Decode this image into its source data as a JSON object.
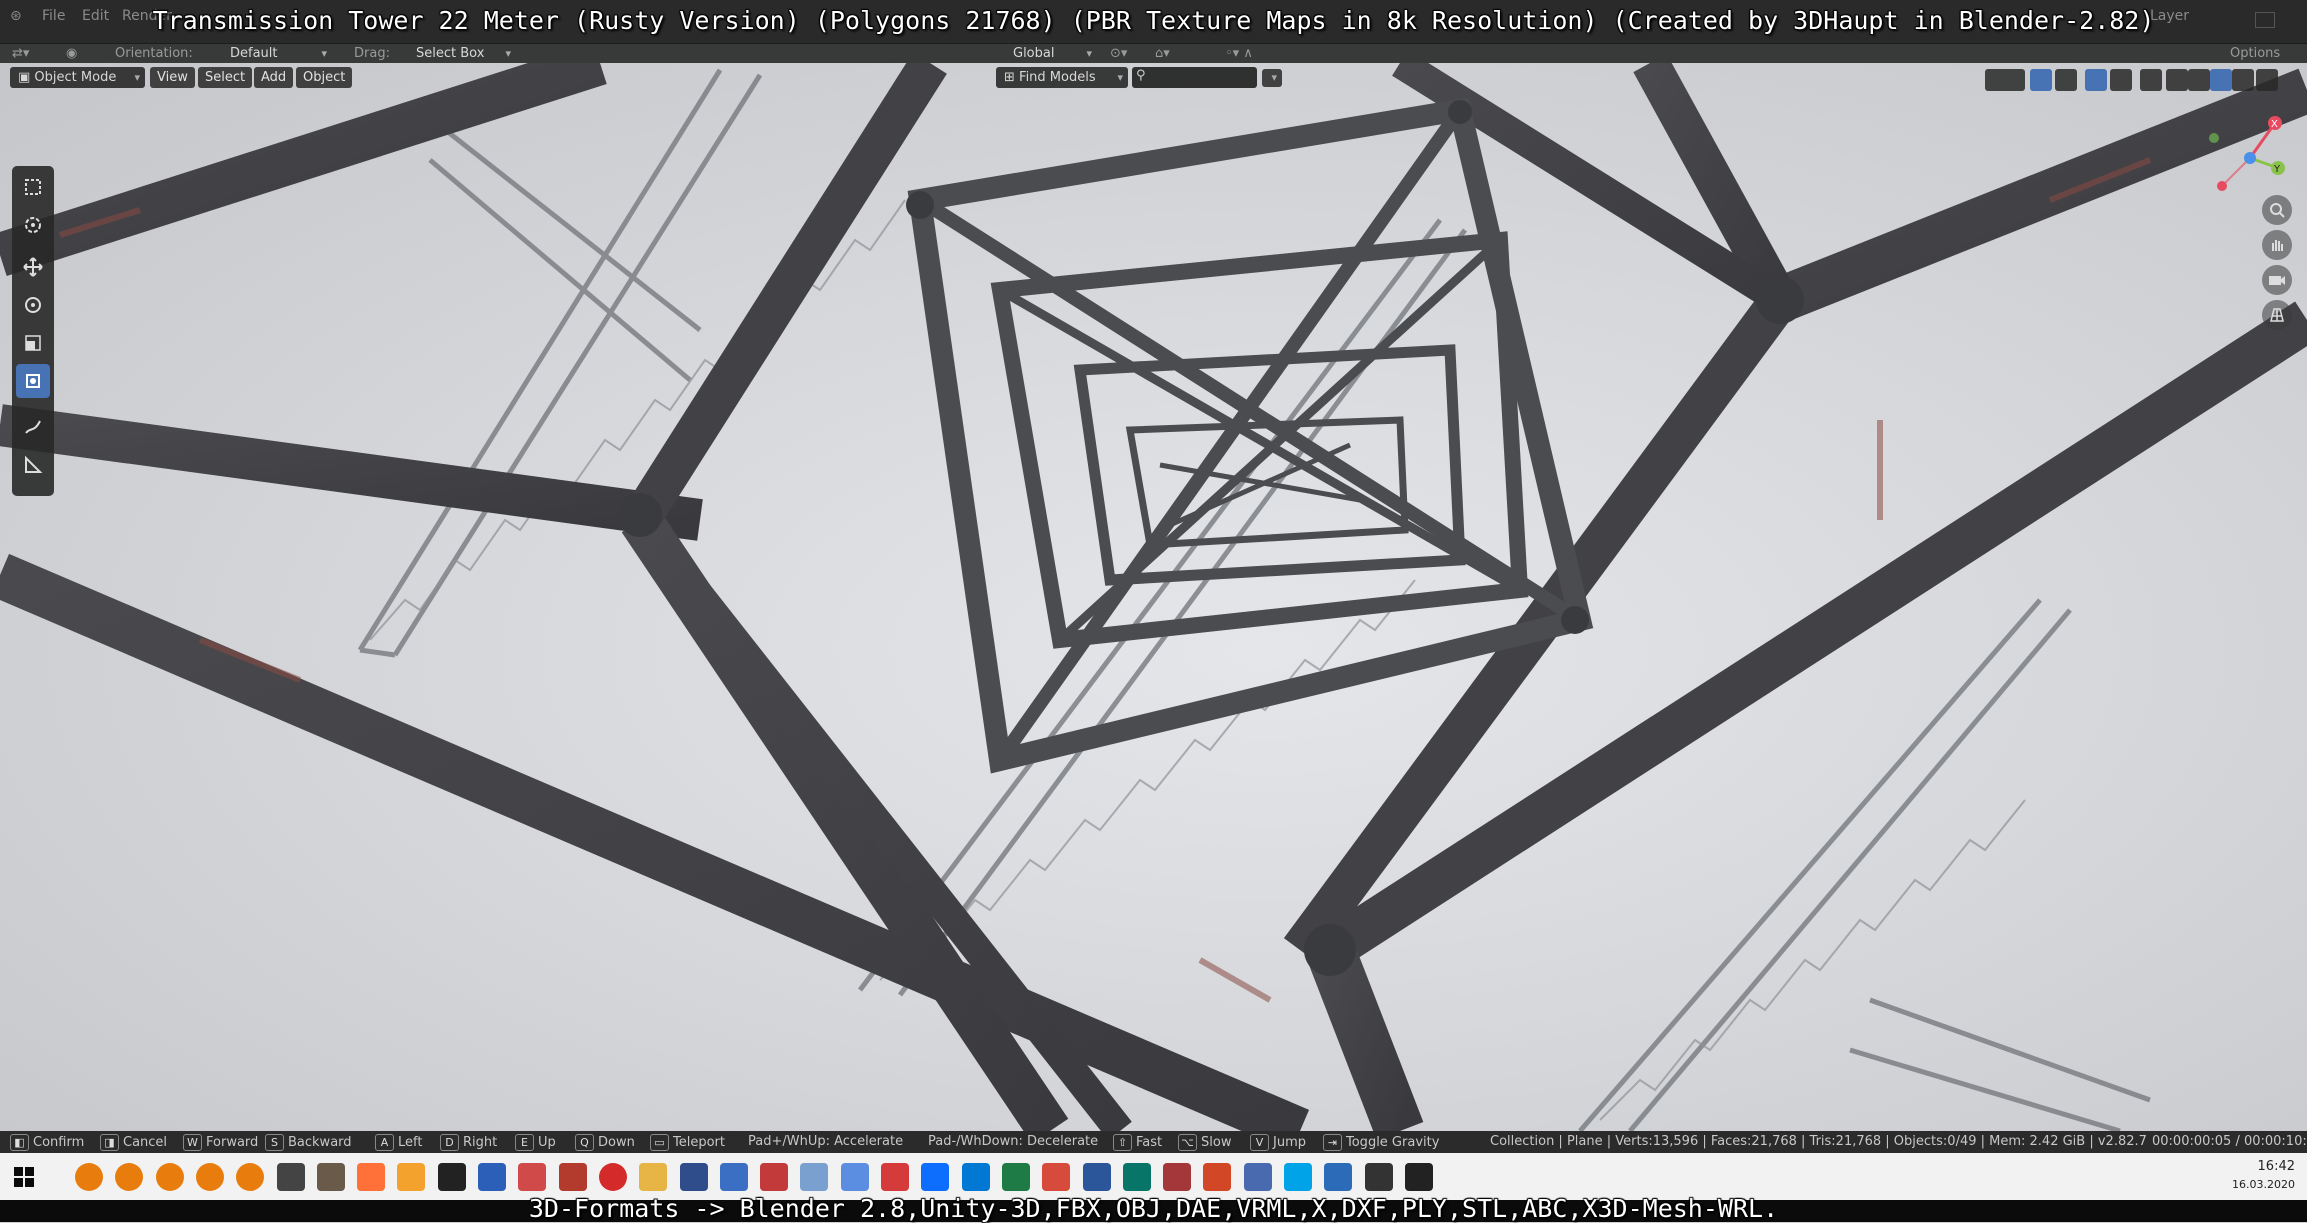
{
  "captions": {
    "top": "Transmission Tower 22 Meter (Rusty Version) (Polygons 21768) (PBR Texture Maps in 8k Resolution) (Created by 3DHaupt in Blender-2.82)",
    "bottom": "3D-Formats -> Blender 2.8,Unity-3D,FBX,OBJ,DAE,VRML,X,DXF,PLY,STL,ABC,X3D-Mesh-WRL."
  },
  "menubar": {
    "items": [
      "File",
      "Edit",
      "Render"
    ],
    "right_label": "Layer"
  },
  "tool_header": {
    "orientation_label": "Orientation:",
    "orientation_value": "Default",
    "drag_label": "Drag:",
    "drag_value": "Select Box",
    "transform_value": "Global",
    "options_label": "Options"
  },
  "viewport_header": {
    "mode": "Object Mode",
    "menus": [
      "View",
      "Select",
      "Add",
      "Object"
    ],
    "find_models": "Find Models",
    "search_placeholder": ""
  },
  "left_tools": [
    "select-box-icon",
    "cursor-icon",
    "move-icon",
    "rotate-icon",
    "scale-icon",
    "transform-icon",
    "annotate-icon",
    "measure-icon"
  ],
  "active_tool_index": 5,
  "nav_gizmo": {
    "axes": [
      "X",
      "Y",
      "Z"
    ],
    "colors": {
      "x": "#e84a5f",
      "y": "#8bc34a",
      "z": "#4a90e8"
    }
  },
  "status_bar": {
    "hints": [
      {
        "key": "",
        "label": "Confirm"
      },
      {
        "key": "",
        "label": "Cancel"
      },
      {
        "key": "W",
        "label": "Forward"
      },
      {
        "key": "S",
        "label": "Backward"
      },
      {
        "key": "A",
        "label": "Left"
      },
      {
        "key": "D",
        "label": "Right"
      },
      {
        "key": "E",
        "label": "Up"
      },
      {
        "key": "Q",
        "label": "Down"
      },
      {
        "key": "",
        "label": "Teleport"
      },
      {
        "key": "",
        "label": "Pad+/WhUp: Accelerate"
      },
      {
        "key": "",
        "label": "Pad-/WhDown: Decelerate"
      },
      {
        "key": "",
        "label": "Fast"
      },
      {
        "key": "",
        "label": "Slow"
      },
      {
        "key": "V",
        "label": "Jump"
      },
      {
        "key": "",
        "label": "Toggle Gravity"
      }
    ],
    "stats": "Collection | Plane | Verts:13,596 | Faces:21,768 | Tris:21,768 | Objects:0/49 | Mem: 2.42 GiB | v2.82.7",
    "timecode": "00:00:00:05 / 00:00:10:"
  },
  "taskbar": {
    "time": "16:42",
    "date": "16.03.2020",
    "icon_colors": [
      "#e87d0d",
      "#e87d0d",
      "#e87d0d",
      "#e87d0d",
      "#e87d0d",
      "#444444",
      "#6a5a4a",
      "#ff7139",
      "#f3a32d",
      "#222222",
      "#2c5fb8",
      "#d04a4a",
      "#b33b2e",
      "#d42a2a",
      "#e6b545",
      "#2e4d8a",
      "#3a6fc4",
      "#c33a3a",
      "#7aa0d0",
      "#5b8de0",
      "#d63b3b",
      "#0d6efd",
      "#0078d4",
      "#1e7b45",
      "#d64b3b",
      "#2b579a",
      "#077568",
      "#a4373a",
      "#d24726",
      "#4a6ab0",
      "#00a2e8",
      "#2c6bb8",
      "#333333",
      "#222222"
    ]
  }
}
